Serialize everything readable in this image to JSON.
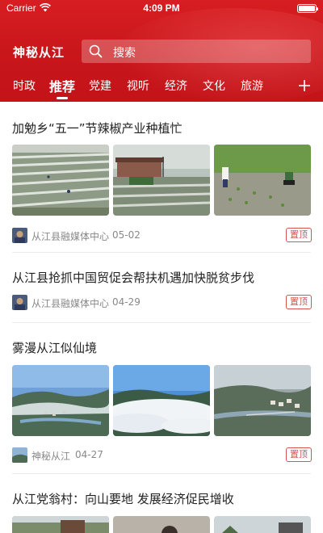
{
  "status_bar": {
    "carrier": "Carrier",
    "time": "4:09 PM"
  },
  "header": {
    "app_title": "神秘从江",
    "search_placeholder": "搜索",
    "tabs": [
      {
        "label": "时政",
        "active": false
      },
      {
        "label": "推荐",
        "active": true
      },
      {
        "label": "党建",
        "active": false
      },
      {
        "label": "视听",
        "active": false
      },
      {
        "label": "经济",
        "active": false
      },
      {
        "label": "文化",
        "active": false
      },
      {
        "label": "旅游",
        "active": false
      }
    ],
    "accent_color": "#d71e22"
  },
  "feed": [
    {
      "title": "加勉乡“五一”节辣椒产业种植忙",
      "source": "从江县融媒体中心",
      "date": "05-02",
      "badge": "置顶",
      "images": [
        "field-photo-1",
        "field-photo-2",
        "field-photo-3"
      ]
    },
    {
      "title": "从江县抢抓中国贸促会帮扶机遇加快脱贫步伐",
      "source": "从江县融媒体中心",
      "date": "04-29",
      "badge": "置顶"
    },
    {
      "title": "雾漫从江似仙境",
      "source": "神秘从江",
      "date": "04-27",
      "badge": "置顶",
      "images": [
        "mist-photo-1",
        "mist-photo-2",
        "mist-photo-3"
      ]
    },
    {
      "title": "从江党翁村：向山要地  发展经济促民增收"
    }
  ]
}
